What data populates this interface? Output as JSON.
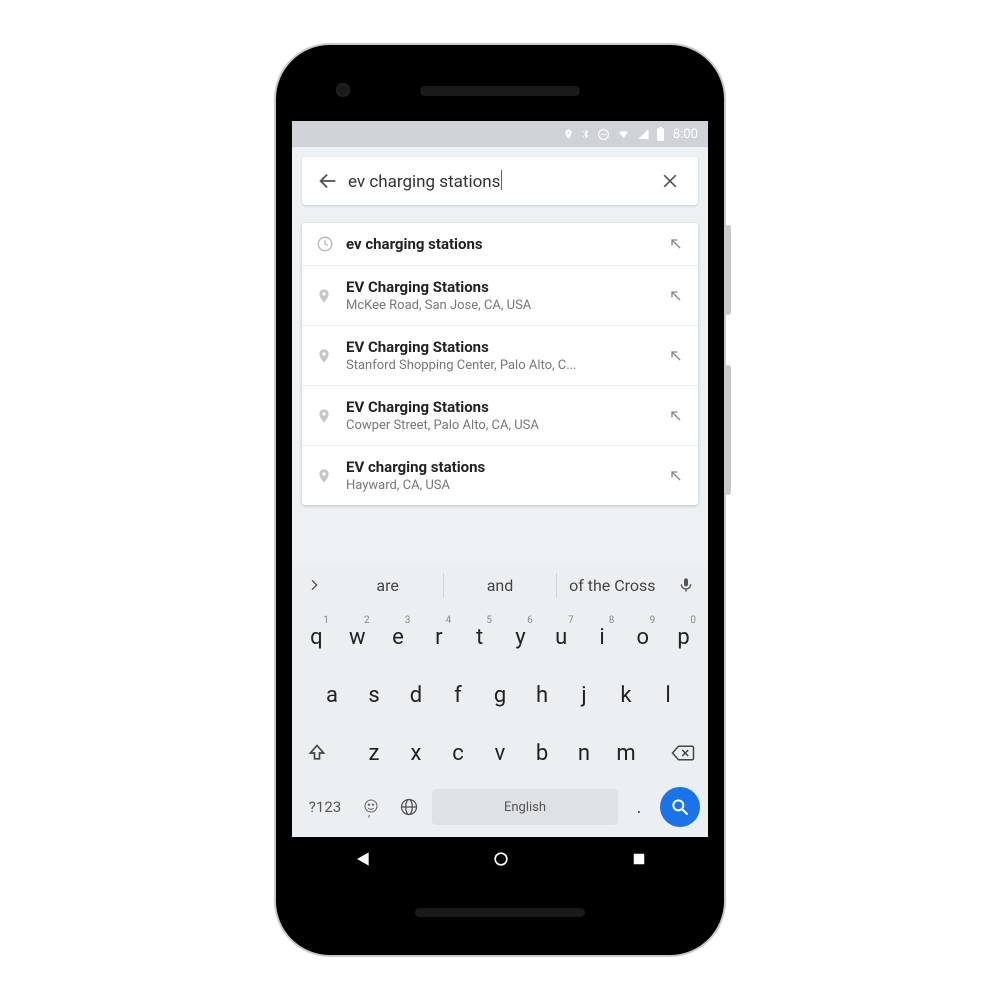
{
  "status": {
    "time": "8:00"
  },
  "search": {
    "query": "ev charging stations"
  },
  "suggestions": [
    {
      "icon": "history",
      "title": "ev charging stations",
      "subtitle": ""
    },
    {
      "icon": "pin",
      "title": "EV Charging Stations",
      "subtitle": "McKee Road, San Jose, CA, USA"
    },
    {
      "icon": "pin",
      "title": "EV Charging Stations",
      "subtitle": "Stanford Shopping Center, Palo Alto, C..."
    },
    {
      "icon": "pin",
      "title": "EV Charging Stations",
      "subtitle": "Cowper Street, Palo Alto, CA, USA"
    },
    {
      "icon": "pin",
      "title": "EV charging stations",
      "subtitle": "Hayward, CA, USA"
    }
  ],
  "keyboard": {
    "suggestions": [
      "are",
      "and",
      "of the Cross"
    ],
    "row1": [
      "q",
      "w",
      "e",
      "r",
      "t",
      "y",
      "u",
      "i",
      "o",
      "p"
    ],
    "row1_hints": [
      "1",
      "2",
      "3",
      "4",
      "5",
      "6",
      "7",
      "8",
      "9",
      "0"
    ],
    "row2": [
      "a",
      "s",
      "d",
      "f",
      "g",
      "h",
      "j",
      "k",
      "l"
    ],
    "row3": [
      "z",
      "x",
      "c",
      "v",
      "b",
      "n",
      "m"
    ],
    "symbols_key": "?123",
    "space_label": "English",
    "period": "."
  }
}
